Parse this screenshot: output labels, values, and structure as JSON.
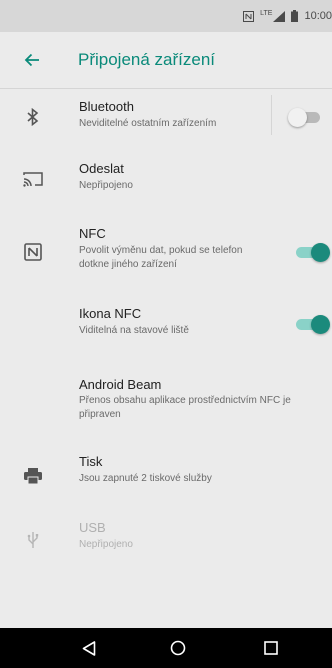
{
  "status_bar": {
    "network": "LTE",
    "time": "10:00"
  },
  "app_bar": {
    "title": "Připojená zařízení"
  },
  "items": [
    {
      "icon": "bluetooth-icon",
      "title": "Bluetooth",
      "subtitle": "Neviditelné ostatním zařízením",
      "switch": "off"
    },
    {
      "icon": "cast-icon",
      "title": "Odeslat",
      "subtitle": "Nepřipojeno"
    },
    {
      "icon": "nfc-icon",
      "title": "NFC",
      "subtitle": "Povolit výměnu dat, pokud se telefon dotkne jiného zařízení",
      "switch": "on"
    },
    {
      "icon": "",
      "title": "Ikona NFC",
      "subtitle": "Viditelná na stavové liště",
      "switch": "on"
    },
    {
      "icon": "",
      "title": "Android Beam",
      "subtitle": "Přenos obsahu aplikace prostřednictvím NFC je připraven"
    },
    {
      "icon": "print-icon",
      "title": "Tisk",
      "subtitle": "Jsou zapnuté 2 tiskové služby"
    },
    {
      "icon": "usb-icon",
      "title": "USB",
      "subtitle": "Nepřipojeno",
      "disabled": true
    }
  ],
  "colors": {
    "accent": "#0a8a7a",
    "background": "#ebebeb",
    "status_bar": "#d7d7d7",
    "nav_bar": "#000000"
  }
}
